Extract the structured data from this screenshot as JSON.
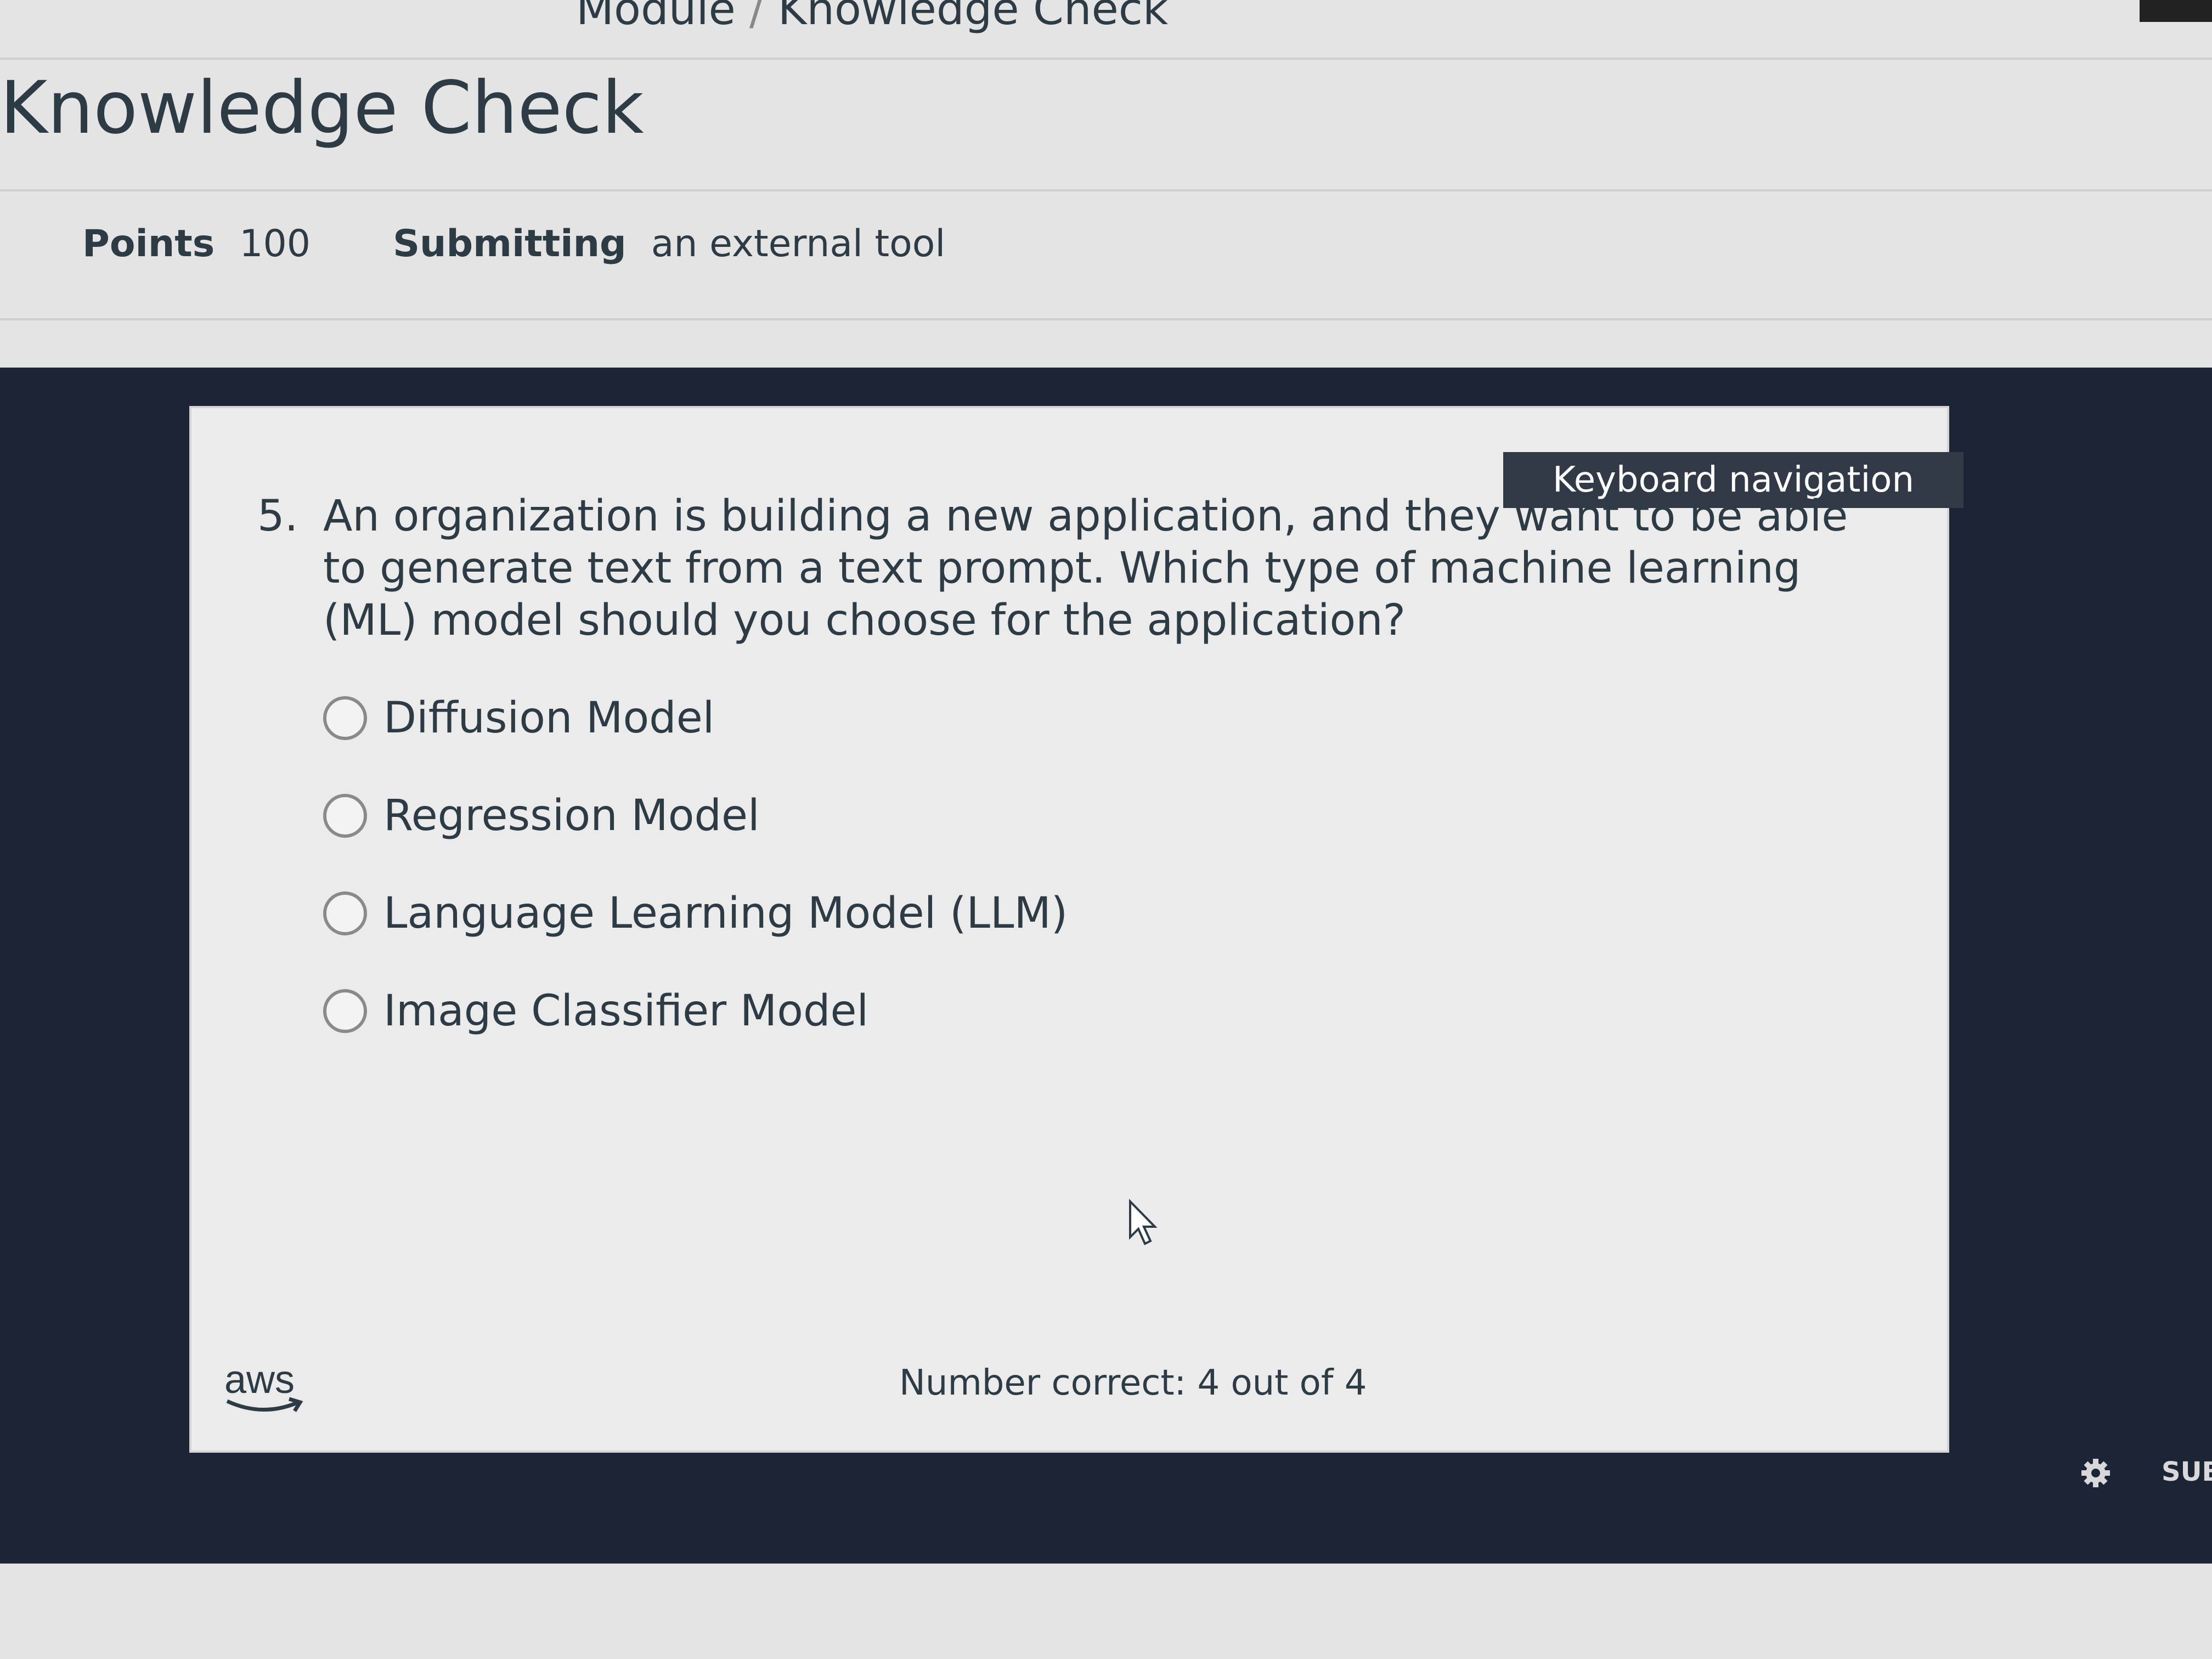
{
  "breadcrumb": {
    "items": [
      "Module",
      "Knowledge Check"
    ],
    "separator": "/"
  },
  "page": {
    "title": "Knowledge Check",
    "points_label": "Points",
    "points_value": "100",
    "submitting_label": "Submitting",
    "submitting_value": "an external tool"
  },
  "quiz": {
    "keyboard_nav_label": "Keyboard navigation",
    "question_number": "5.",
    "question_text": "An organization is building a new application, and they want to be able to generate text from a text prompt. Which type of machine learning (ML) model should you choose for the application?",
    "options": [
      "Diffusion Model",
      "Regression Model",
      "Language Learning Model (LLM)",
      "Image Classifier Model"
    ],
    "score_text": "Number correct: 4 out of 4",
    "logo_text": "aws"
  },
  "footer": {
    "settings_icon": "gear-icon",
    "submit_label": "SUB"
  },
  "colors": {
    "frame_bg": "#1b2535",
    "card_bg": "#ebebeb",
    "text": "#2d3b45",
    "kbd_nav_bg": "#313a46"
  }
}
